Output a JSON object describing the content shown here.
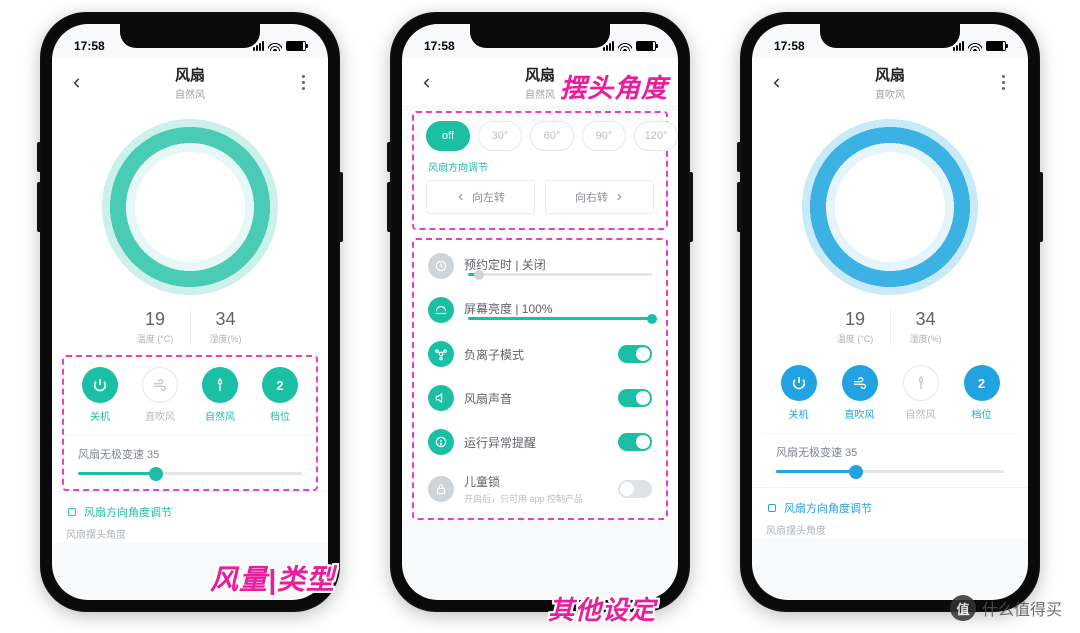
{
  "status_time": "17:58",
  "header": {
    "title": "风扇",
    "modeA": "自然风",
    "modeB": "自然风",
    "modeC": "直吹风"
  },
  "metrics": {
    "temp_value": "19",
    "temp_label": "温度 (°C)",
    "hum_value": "34",
    "hum_label": "湿度(%)"
  },
  "phoneA": {
    "modes": {
      "power": "关机",
      "direct": "直吹风",
      "natural": "自然风",
      "level": "档位",
      "level_badge": "2"
    },
    "slider_label": "风扇无极变速 35",
    "slider_pct": 35,
    "foot_link": "风扇方向角度调节",
    "foot_sub": "风扇摆头角度"
  },
  "phoneB": {
    "angles": {
      "off": "off",
      "a30": "30°",
      "a60": "60°",
      "a90": "90°",
      "a120": "120°"
    },
    "section_dir": "风扇方向调节",
    "dir_left": "向左转",
    "dir_right": "向右转",
    "settings": {
      "timer": "预约定时 | 关闭",
      "brightness": "屏幕亮度 | 100%",
      "ion": "负离子模式",
      "sound": "风扇声音",
      "alert": "运行异常提醒",
      "childlock": "儿童锁",
      "childlock_sub": "开启后，只可用 app 控制产品"
    },
    "brightness_pct": 100,
    "timer_pct": 6,
    "toggles": {
      "ion": true,
      "sound": true,
      "alert": true,
      "childlock": false
    }
  },
  "phoneC": {
    "modes": {
      "power": "关机",
      "direct": "直吹风",
      "natural": "自然风",
      "level": "档位",
      "level_badge": "2"
    },
    "slider_label": "风扇无极变速 35",
    "slider_pct": 35,
    "foot_link": "风扇方向角度调节",
    "foot_sub": "风扇摆头角度"
  },
  "annotations": {
    "swing": "摆头角度",
    "wind": "风量|类型",
    "other": "其他设定"
  },
  "watermark": {
    "badge": "值",
    "text": "什么值得买"
  }
}
